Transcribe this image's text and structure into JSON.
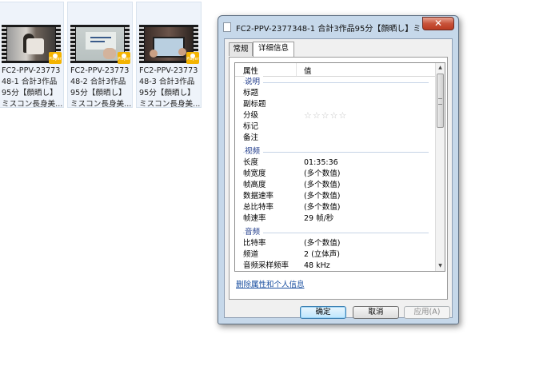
{
  "files": [
    {
      "name_line1": "FC2-PPV-23773",
      "name_line2": "48-1 合計3作品",
      "name_line3": "95分【顔晒し】",
      "name_line4": "ミスコン長身美...",
      "badge": "Player"
    },
    {
      "name_line1": "FC2-PPV-23773",
      "name_line2": "48-2 合計3作品",
      "name_line3": "95分【顔晒し】",
      "name_line4": "ミスコン長身美...",
      "badge": "Player"
    },
    {
      "name_line1": "FC2-PPV-23773",
      "name_line2": "48-3 合計3作品",
      "name_line3": "95分【顔晒し】",
      "name_line4": "ミスコン長身美...",
      "badge": "Player"
    }
  ],
  "dialog": {
    "title": "FC2-PPV-2377348-1 合計3作品95分【顔晒し】ミ...",
    "close_glyph": "✕",
    "tabs": [
      "常规",
      "详细信息"
    ],
    "header": {
      "property": "属性",
      "value": "值"
    },
    "groups": {
      "description": "说明",
      "video": "视频",
      "audio": "音频"
    },
    "rows": {
      "title": {
        "k": "标题",
        "v": ""
      },
      "subtitle": {
        "k": "副标题",
        "v": ""
      },
      "rating": {
        "k": "分级",
        "stars": "☆☆☆☆☆"
      },
      "tags": {
        "k": "标记",
        "v": ""
      },
      "comments": {
        "k": "备注",
        "v": ""
      },
      "length": {
        "k": "长度",
        "v": "01:35:36"
      },
      "frame_width": {
        "k": "帧宽度",
        "v": "(多个数值)"
      },
      "frame_height": {
        "k": "帧高度",
        "v": "(多个数值)"
      },
      "data_rate": {
        "k": "数据速率",
        "v": "(多个数值)"
      },
      "total_bitrate": {
        "k": "总比特率",
        "v": "(多个数值)"
      },
      "frame_rate": {
        "k": "帧速率",
        "v": "29 帧/秒"
      },
      "bitrate": {
        "k": "比特率",
        "v": "(多个数值)"
      },
      "channels": {
        "k": "频道",
        "v": "2 (立体声)"
      },
      "sample_rate": {
        "k": "音频采样频率",
        "v": "48 kHz"
      }
    },
    "remove_link": "删除属性和个人信息",
    "buttons": {
      "ok": "确定",
      "cancel": "取消",
      "apply": "应用(A)"
    }
  }
}
